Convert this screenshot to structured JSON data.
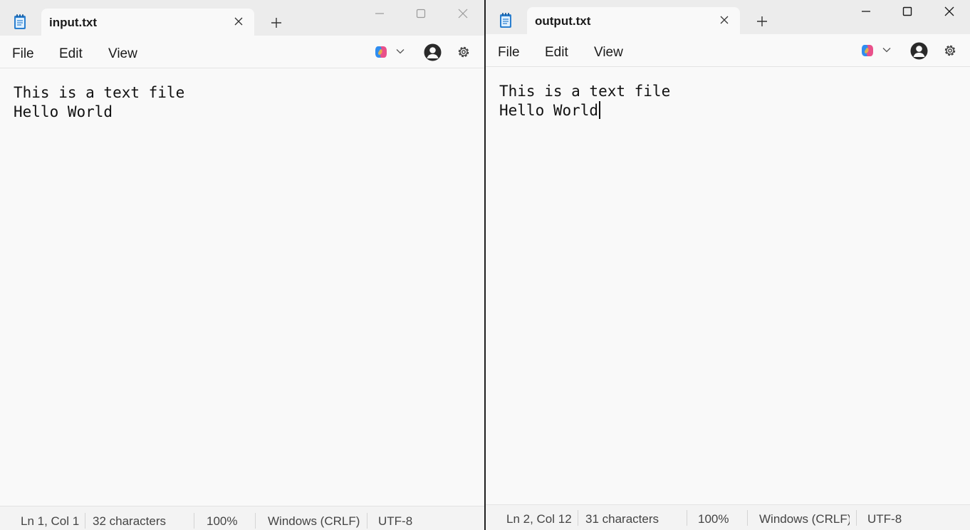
{
  "left_window": {
    "tab_title": "input.txt",
    "menu": {
      "file": "File",
      "edit": "Edit",
      "view": "View"
    },
    "lines": [
      "This is a text file",
      "Hello World"
    ],
    "status": {
      "position": "Ln 1, Col 1",
      "chars": "32 characters",
      "zoom": "100%",
      "line_ending": "Windows (CRLF)",
      "encoding": "UTF-8"
    }
  },
  "right_window": {
    "tab_title": "output.txt",
    "menu": {
      "file": "File",
      "edit": "Edit",
      "view": "View"
    },
    "lines": [
      "This is a text file",
      "Hello World"
    ],
    "status": {
      "position": "Ln 2, Col 12",
      "chars": "31 characters",
      "zoom": "100%",
      "line_ending": "Windows (CRLF)",
      "encoding": "UTF-8"
    }
  },
  "icons": {
    "app": "notepad-icon",
    "tab_close": "close-icon",
    "new_tab": "plus-icon",
    "copilot": "copilot-icon",
    "dropdown": "chevron-down-icon",
    "profile": "profile-icon",
    "settings": "gear-icon",
    "minimize": "minimize-icon",
    "maximize": "maximize-icon",
    "window_close": "close-icon"
  },
  "colors": {
    "titlebar": "#ececec",
    "editor_bg": "#f9f9f9",
    "statusbar": "#f3f3f3",
    "text": "#1a1a1a"
  }
}
